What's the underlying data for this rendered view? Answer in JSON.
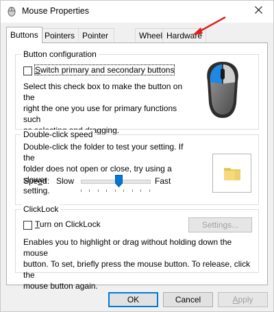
{
  "window": {
    "title": "Mouse Properties",
    "close_icon": "close-icon"
  },
  "tabs": [
    {
      "label": "Buttons",
      "active": true
    },
    {
      "label": "Pointers",
      "active": false
    },
    {
      "label": "Pointer Options",
      "active": false
    },
    {
      "label": "Wheel",
      "active": false
    },
    {
      "label": "Hardware",
      "active": false
    }
  ],
  "button_configuration": {
    "title": "Button configuration",
    "checkbox_label": "Switch primary and secondary buttons",
    "checked": false,
    "description": "Select this check box to make the button on the right the one you use for primary functions such as selecting and dragging.",
    "desc_lines": [
      "Select this check box to make the button on the",
      "right the one you use for primary functions such",
      "as selecting and dragging."
    ]
  },
  "double_click": {
    "title": "Double-click speed",
    "desc_lines": [
      "Double-click the folder to test your setting. If the",
      "folder does not open or close, try using a slower",
      "setting."
    ],
    "speed_label": "Speed:",
    "slow_label": "Slow",
    "fast_label": "Fast",
    "slider_level": 0.55
  },
  "clicklock": {
    "title": "ClickLock",
    "checkbox_label": "Turn on ClickLock",
    "checked": false,
    "settings_button": "Settings...",
    "desc_lines": [
      "Enables you to highlight or drag without holding down the mouse",
      "button. To set, briefly press the mouse button. To release, click the",
      "mouse button again."
    ]
  },
  "footer": {
    "ok": "OK",
    "cancel": "Cancel",
    "apply": "Apply"
  },
  "colors": {
    "accent": "#0078d7",
    "arrow": "#e02020"
  }
}
